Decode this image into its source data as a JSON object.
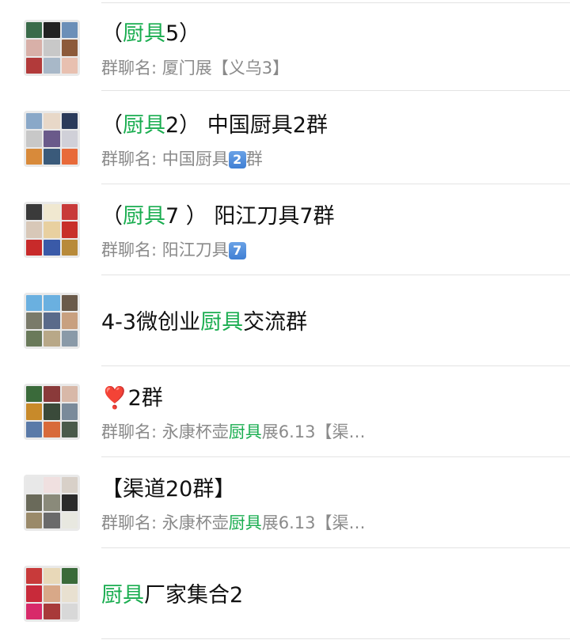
{
  "colors": {
    "highlight": "#1aad50",
    "muted": "#8a8a8a",
    "separator": "#e3e3e3"
  },
  "rows": [
    {
      "title_pre": "（",
      "title_hl": "厨具",
      "title_post": "5）",
      "sub_pre": "群聊名: 厦门展【义乌3】",
      "sub_hl": "",
      "sub_post": "",
      "sub_badge": ""
    },
    {
      "title_pre": "（",
      "title_hl": "厨具",
      "title_post": "2）  中国厨具2群",
      "sub_pre": "群聊名: 中国厨具",
      "sub_hl": "",
      "sub_post": "群",
      "sub_badge": "2"
    },
    {
      "title_pre": "（",
      "title_hl": "厨具",
      "title_post": "7 ）   阳江刀具7群",
      "sub_pre": "群聊名: 阳江刀具",
      "sub_hl": "",
      "sub_post": "",
      "sub_badge": "7"
    },
    {
      "title_pre": "4-3微创业",
      "title_hl": "厨具",
      "title_post": "交流群"
    },
    {
      "title_pre": "❣️",
      "title_hl": "",
      "title_post": "2群",
      "sub_pre": "群聊名: 永康杯壶",
      "sub_hl": "厨具",
      "sub_post": "展6.13【渠…",
      "sub_badge": ""
    },
    {
      "title_pre": "【渠道20群】",
      "title_hl": "",
      "title_post": "",
      "sub_pre": "群聊名: 永康杯壶",
      "sub_hl": "厨具",
      "sub_post": "展6.13【渠…",
      "sub_badge": ""
    },
    {
      "title_pre": "",
      "title_hl": "厨具",
      "title_post": "厂家集合2"
    }
  ]
}
